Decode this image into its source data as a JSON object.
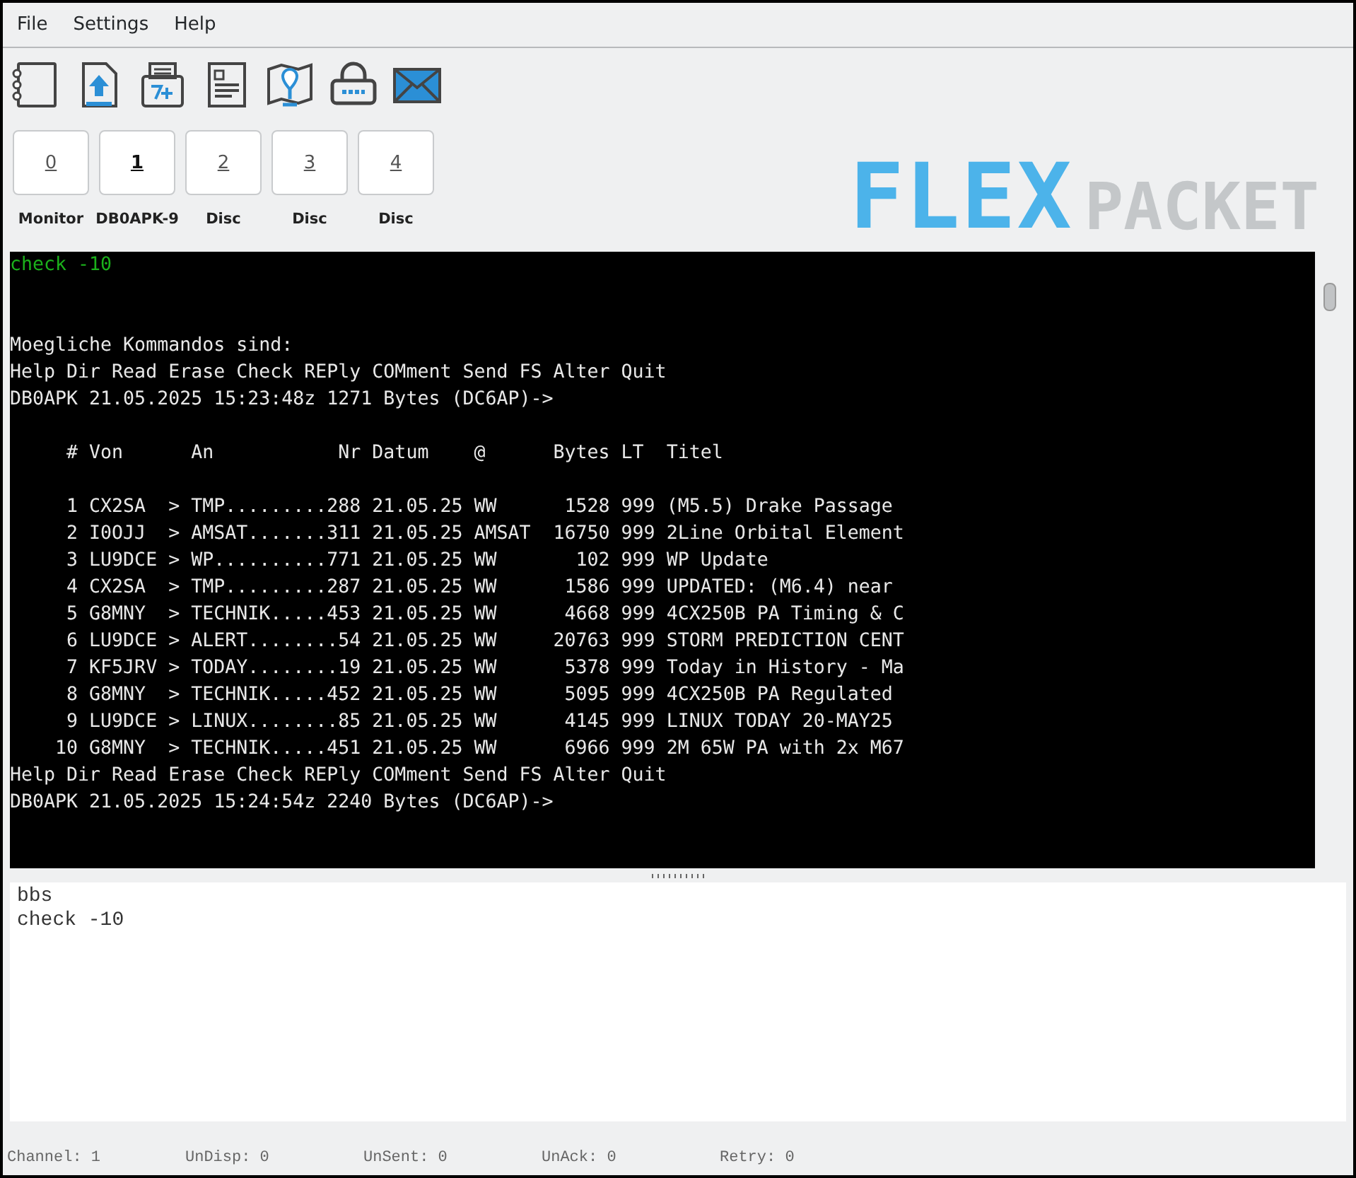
{
  "menu": [
    "File",
    "Settings",
    "Help"
  ],
  "toolbar": [
    {
      "kind": "notebook"
    },
    {
      "kind": "upload"
    },
    {
      "kind": "printer"
    },
    {
      "kind": "document"
    },
    {
      "kind": "map"
    },
    {
      "kind": "lock"
    },
    {
      "kind": "mail"
    }
  ],
  "channels": [
    {
      "number": "0",
      "label": "Monitor",
      "selected": false
    },
    {
      "number": "1",
      "label": "DB0APK-9",
      "selected": true
    },
    {
      "number": "2",
      "label": "Disc",
      "selected": false
    },
    {
      "number": "3",
      "label": "Disc",
      "selected": false
    },
    {
      "number": "4",
      "label": "Disc",
      "selected": false
    }
  ],
  "logo": {
    "part_1": "FLEX",
    "part_2": "PACKET"
  },
  "terminal": [
    {
      "kind": "echo",
      "text": "check -10"
    },
    {
      "kind": "blank"
    },
    {
      "kind": "blank"
    },
    {
      "kind": "output",
      "text": "Moegliche Kommandos sind:"
    },
    {
      "kind": "output",
      "text": "Help Dir Read Erase Check REPly COMment Send FS Alter Quit"
    },
    {
      "kind": "output",
      "text": "DB0APK 21.05.2025 15:23:48z 1271 Bytes (DC6AP)->"
    },
    {
      "kind": "blank"
    },
    {
      "kind": "output",
      "text": "     # Von      An           Nr Datum    @      Bytes LT  Titel"
    },
    {
      "kind": "blank"
    },
    {
      "kind": "output",
      "text": "     1 CX2SA  > TMP.........288 21.05.25 WW      1528 999 (M5.5) Drake Passage"
    },
    {
      "kind": "output",
      "text": "     2 I0OJJ  > AMSAT.......311 21.05.25 AMSAT  16750 999 2Line Orbital Element"
    },
    {
      "kind": "output",
      "text": "     3 LU9DCE > WP..........771 21.05.25 WW       102 999 WP Update"
    },
    {
      "kind": "output",
      "text": "     4 CX2SA  > TMP.........287 21.05.25 WW      1586 999 UPDATED: (M6.4) near"
    },
    {
      "kind": "output",
      "text": "     5 G8MNY  > TECHNIK.....453 21.05.25 WW      4668 999 4CX250B PA Timing & C"
    },
    {
      "kind": "output",
      "text": "     6 LU9DCE > ALERT........54 21.05.25 WW     20763 999 STORM PREDICTION CENT"
    },
    {
      "kind": "output",
      "text": "     7 KF5JRV > TODAY........19 21.05.25 WW      5378 999 Today in History - Ma"
    },
    {
      "kind": "output",
      "text": "     8 G8MNY  > TECHNIK.....452 21.05.25 WW      5095 999 4CX250B PA Regulated"
    },
    {
      "kind": "output",
      "text": "     9 LU9DCE > LINUX........85 21.05.25 WW      4145 999 LINUX TODAY 20-MAY25"
    },
    {
      "kind": "output",
      "text": "    10 G8MNY  > TECHNIK.....451 21.05.25 WW      6966 999 2M 65W PA with 2x M67"
    },
    {
      "kind": "output",
      "text": "Help Dir Read Erase Check REPly COMment Send FS Alter Quit"
    },
    {
      "kind": "output",
      "text": "DB0APK 21.05.2025 15:24:54z 2240 Bytes (DC6AP)->"
    }
  ],
  "input": [
    "bbs",
    "check -10"
  ],
  "status_bar": [
    "Channel: 1",
    "UnDisp: 0",
    "UnSent: 0",
    "UnAck: 0",
    "Retry: 0"
  ]
}
